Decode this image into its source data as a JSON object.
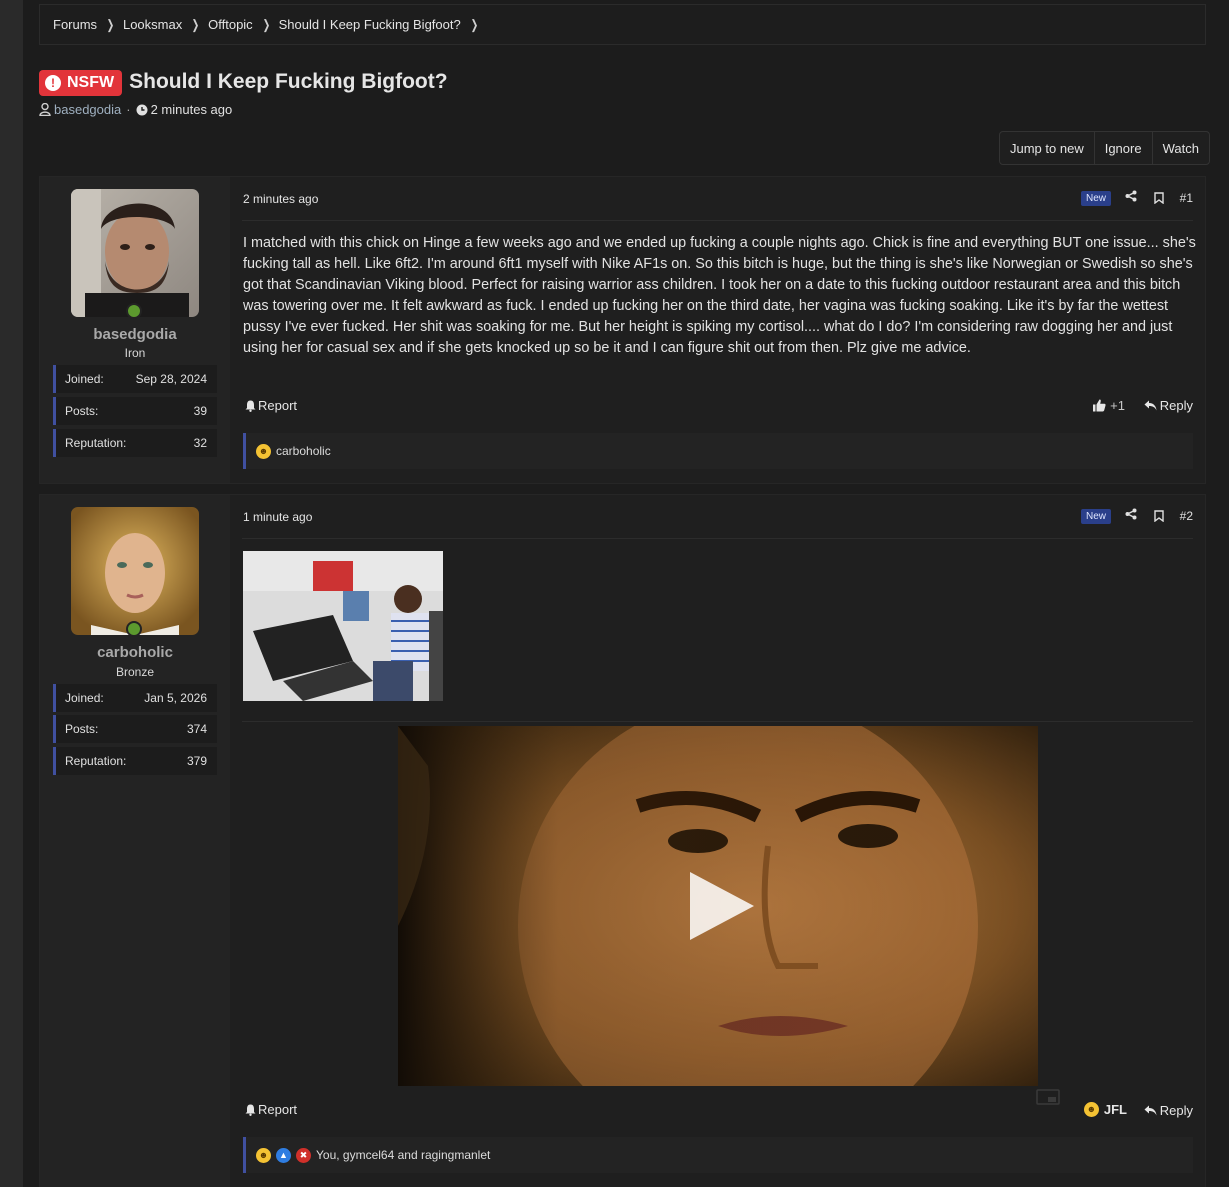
{
  "breadcrumb": [
    "Forums",
    "Looksmax",
    "Offtopic",
    "Should I Keep Fucking Bigfoot?"
  ],
  "thread": {
    "prefix": "NSFW",
    "title": "Should I Keep Fucking Bigfoot?",
    "author": "basedgodia",
    "time": "2 minutes ago"
  },
  "actions": {
    "jump": "Jump to new",
    "ignore": "Ignore",
    "watch": "Watch"
  },
  "labels": {
    "joined": "Joined:",
    "posts": "Posts:",
    "reputation": "Reputation:",
    "new": "New",
    "report": "Report",
    "reply": "Reply"
  },
  "posts": [
    {
      "user": "basedgodia",
      "rank": "Iron",
      "joined": "Sep 28, 2024",
      "post_count": "39",
      "reputation": "32",
      "time": "2 minutes ago",
      "number": "#1",
      "body": "I matched with this chick on Hinge a few weeks ago and we ended up fucking a couple nights ago. Chick is fine and everything BUT one issue... she's fucking tall as hell. Like 6ft2. I'm around 6ft1 myself with Nike AF1s on. So this bitch is huge, but the thing is she's like Norwegian or Swedish so she's got that Scandinavian Viking blood. Perfect for raising warrior ass children. I took her on a date to this fucking outdoor restaurant area and this bitch was towering over me. It felt awkward as fuck. I ended up fucking her on the third date, her vagina was fucking soaking. Like it's by far the wettest pussy I've ever fucked. Her shit was soaking for me. But her height is spiking my cortisol.... what do I do? I'm considering raw dogging her and just using her for casual sex and if she gets knocked up so be it and I can figure shit out from then. Plz give me advice.",
      "reaction_label": "+1",
      "reacted_by": "carboholic"
    },
    {
      "user": "carboholic",
      "rank": "Bronze",
      "joined": "Jan 5, 2026",
      "post_count": "374",
      "reputation": "379",
      "time": "1 minute ago",
      "number": "#2",
      "reaction_label": "JFL",
      "reacted_by": "You, gymcel64 and ragingmanlet"
    }
  ],
  "colors": {
    "nsfw": "#e2343a",
    "accent": "#4050a0",
    "online": "#5c9a2e",
    "new_badge": "#2a3f8a"
  }
}
